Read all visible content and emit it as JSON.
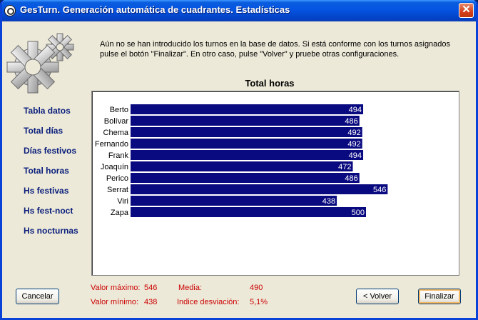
{
  "window": {
    "title": "GesTurn. Generación automática de cuadrantes. Estadísticas",
    "close_glyph": "✕"
  },
  "message": "Aún no se han introducido los turnos en la base de datos. Si está conforme con los turnos asignados pulse el botón \"Finalizar\". En otro caso, pulse \"Volver\" y pruebe otras configuraciones.",
  "nav": {
    "items": [
      {
        "label": "Tabla datos"
      },
      {
        "label": "Total días"
      },
      {
        "label": "Días festivos"
      },
      {
        "label": "Total horas"
      },
      {
        "label": "Hs festivas"
      },
      {
        "label": "Hs fest-noct"
      },
      {
        "label": "Hs nocturnas"
      }
    ]
  },
  "chart_data": {
    "type": "bar",
    "orientation": "horizontal",
    "title": "Total horas",
    "categories": [
      "Berto",
      "Bolívar",
      "Chema",
      "Fernando",
      "Frank",
      "Joaquín",
      "Perico",
      "Serrat",
      "Viri",
      "Zapa"
    ],
    "values": [
      494,
      486,
      492,
      492,
      494,
      472,
      486,
      546,
      438,
      500
    ],
    "xlim": [
      0,
      600
    ],
    "bar_color": "#0a0a80",
    "label_color": "#ffffff",
    "grid": false
  },
  "stats": {
    "max_label": "Valor máximo:",
    "max_value": "546",
    "min_label": "Valor mínimo:",
    "min_value": "438",
    "mean_label": "Media:",
    "mean_value": "490",
    "dev_label": "Indice desviación:",
    "dev_value": "5,1%"
  },
  "buttons": {
    "cancel": "Cancelar",
    "back": "< Volver",
    "finish": "Finalizar"
  },
  "colors": {
    "title_bar": "#0554e2",
    "nav_text": "#0a1e7c",
    "stats_text": "#cc0000"
  }
}
